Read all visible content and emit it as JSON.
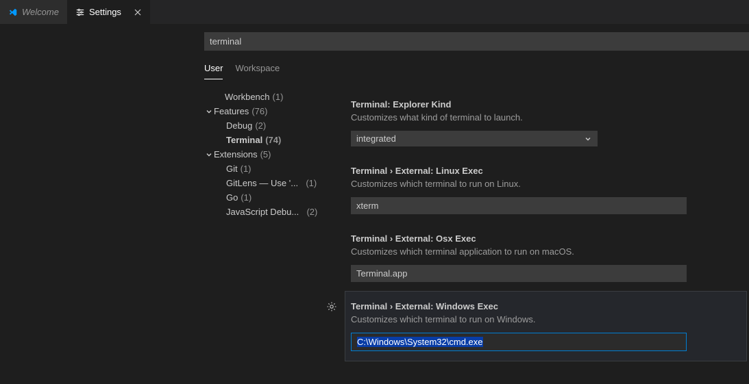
{
  "tabs": {
    "welcome": "Welcome",
    "settings": "Settings"
  },
  "search": {
    "value": "terminal"
  },
  "scope": {
    "user": "User",
    "workspace": "Workspace"
  },
  "toc": {
    "workbench": {
      "label": "Workbench",
      "count": "(1)"
    },
    "features": {
      "label": "Features",
      "count": "(76)"
    },
    "debug": {
      "label": "Debug",
      "count": "(2)"
    },
    "terminal": {
      "label": "Terminal",
      "count": "(74)"
    },
    "extensions": {
      "label": "Extensions",
      "count": "(5)"
    },
    "git": {
      "label": "Git",
      "count": "(1)"
    },
    "gitlens": {
      "label": "GitLens — Use '...",
      "count": "(1)"
    },
    "go": {
      "label": "Go",
      "count": "(1)"
    },
    "jsdebug": {
      "label": "JavaScript Debu...",
      "count": "(2)"
    }
  },
  "settings": {
    "explorerKind": {
      "cat": "Terminal:",
      "name": "Explorer Kind",
      "desc": "Customizes what kind of terminal to launch.",
      "value": "integrated"
    },
    "linuxExec": {
      "cat": "Terminal › External:",
      "name": "Linux Exec",
      "desc": "Customizes which terminal to run on Linux.",
      "value": "xterm"
    },
    "osxExec": {
      "cat": "Terminal › External:",
      "name": "Osx Exec",
      "desc": "Customizes which terminal application to run on macOS.",
      "value": "Terminal.app"
    },
    "windowsExec": {
      "cat": "Terminal › External:",
      "name": "Windows Exec",
      "desc": "Customizes which terminal to run on Windows.",
      "value": "C:\\Windows\\System32\\cmd.exe"
    }
  }
}
